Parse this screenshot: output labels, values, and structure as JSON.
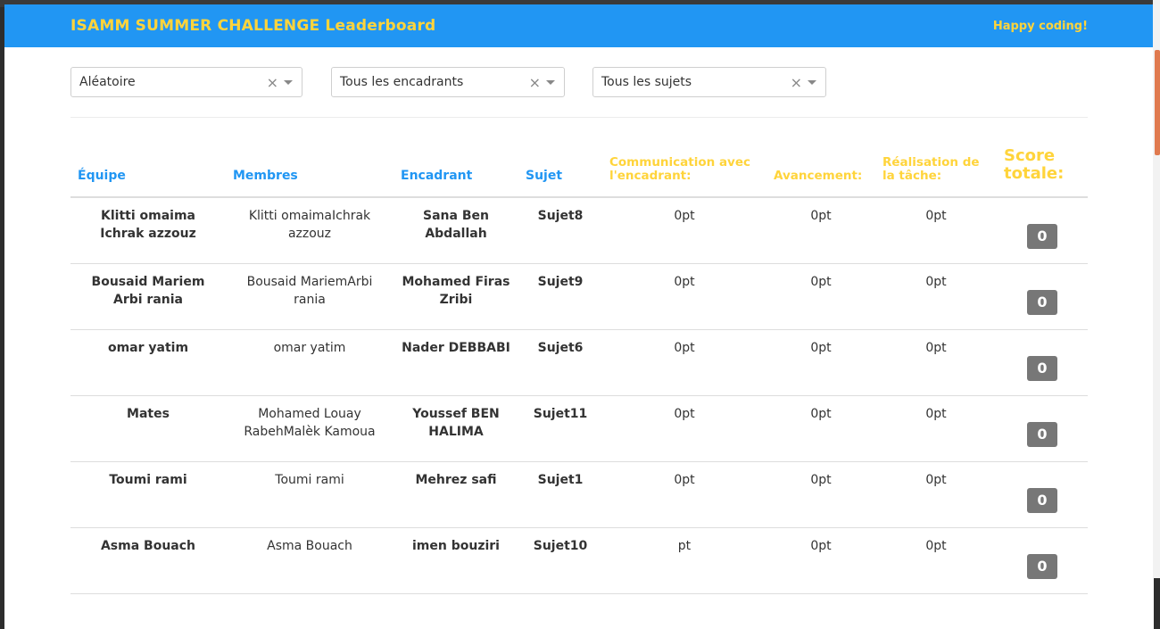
{
  "header": {
    "title": "ISAMM SUMMER CHALLENGE Leaderboard",
    "tagline": "Happy coding!"
  },
  "filters": {
    "order": {
      "value": "Aléatoire",
      "clear_icon": "×"
    },
    "supervisor": {
      "value": "Tous les encadrants",
      "clear_icon": "×"
    },
    "subject": {
      "value": "Tous les sujets",
      "clear_icon": "×"
    }
  },
  "table": {
    "headers": {
      "team": "Équipe",
      "members": "Membres",
      "supervisor": "Encadrant",
      "subject": "Sujet",
      "communication": "Communication avec l'encadrant:",
      "progress": "Avancement:",
      "realisation": "Réalisation de la tâche:",
      "score": "Score totale:"
    },
    "rows": [
      {
        "team": "Klitti omaima Ichrak azzouz",
        "members": "Klitti omaimaIchrak azzouz",
        "supervisor": "Sana Ben Abdallah",
        "subject": "Sujet8",
        "communication": "0pt",
        "progress": "0pt",
        "realisation": "0pt",
        "score": "0"
      },
      {
        "team": "Bousaid Mariem Arbi rania",
        "members": "Bousaid MariemArbi rania",
        "supervisor": "Mohamed Firas Zribi",
        "subject": "Sujet9",
        "communication": "0pt",
        "progress": "0pt",
        "realisation": "0pt",
        "score": "0"
      },
      {
        "team": "omar yatim",
        "members": "omar yatim",
        "supervisor": "Nader DEBBABI",
        "subject": "Sujet6",
        "communication": "0pt",
        "progress": "0pt",
        "realisation": "0pt",
        "score": "0"
      },
      {
        "team": "Mates",
        "members": "Mohamed Louay RabehMalèk Kamoua",
        "supervisor": "Youssef BEN HALIMA",
        "subject": "Sujet11",
        "communication": "0pt",
        "progress": "0pt",
        "realisation": "0pt",
        "score": "0"
      },
      {
        "team": "Toumi rami",
        "members": "Toumi rami",
        "supervisor": "Mehrez safi",
        "subject": "Sujet1",
        "communication": "0pt",
        "progress": "0pt",
        "realisation": "0pt",
        "score": "0"
      },
      {
        "team": "Asma Bouach",
        "members": "Asma Bouach",
        "supervisor": "imen bouziri",
        "subject": "Sujet10",
        "communication": "pt",
        "progress": "0pt",
        "realisation": "0pt",
        "score": "0"
      }
    ]
  }
}
